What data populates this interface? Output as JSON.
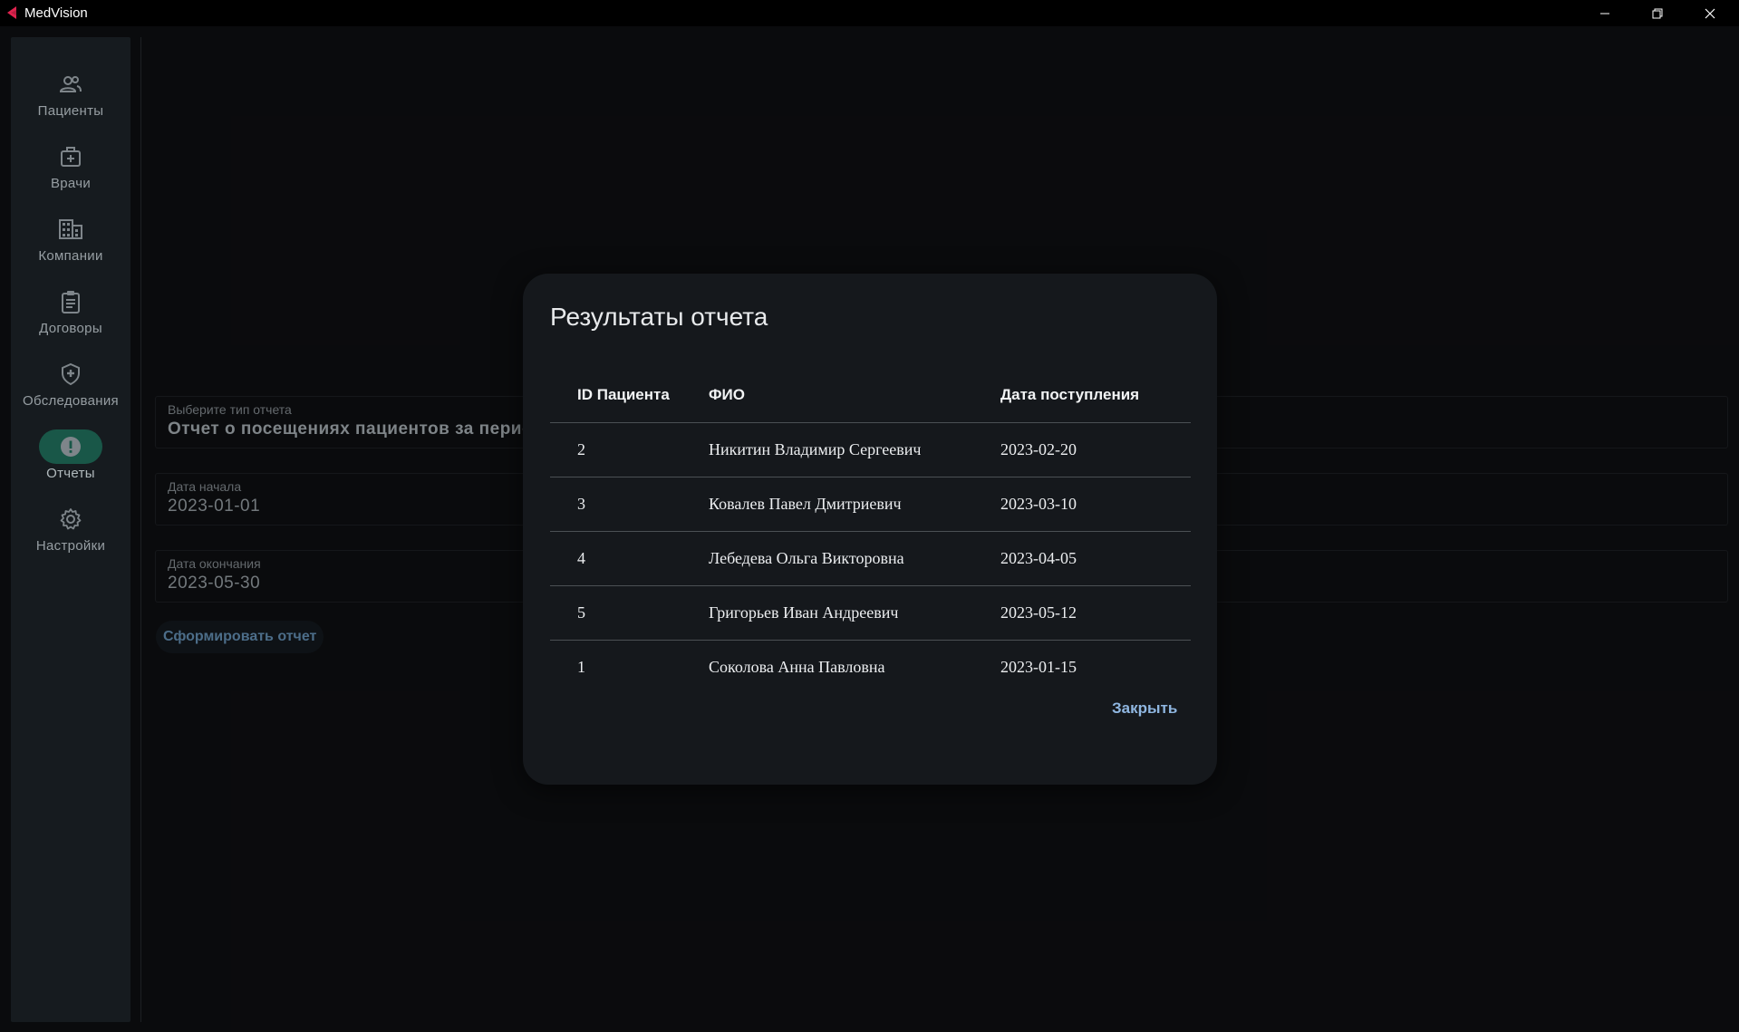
{
  "window": {
    "title": "MedVision",
    "accent_color": "#e0234e"
  },
  "sidebar": {
    "items": [
      {
        "label": "Пациенты",
        "icon": "people-icon"
      },
      {
        "label": "Врачи",
        "icon": "medical-bag-icon"
      },
      {
        "label": "Компании",
        "icon": "building-icon"
      },
      {
        "label": "Договоры",
        "icon": "clipboard-icon"
      },
      {
        "label": "Обследования",
        "icon": "shield-plus-icon"
      },
      {
        "label": "Отчеты",
        "icon": "alert-circle-icon",
        "active": true
      },
      {
        "label": "Настройки",
        "icon": "gear-icon"
      }
    ],
    "active_color": "#1f6b58"
  },
  "form": {
    "report_type_label": "Выберите тип отчета",
    "report_type_value": "Отчет о посещениях пациентов за период",
    "start_date_label": "Дата начала",
    "start_date_value": "2023-01-01",
    "end_date_label": "Дата окончания",
    "end_date_value": "2023-05-30",
    "generate_label": "Сформировать отчет"
  },
  "dialog": {
    "title": "Результаты отчета",
    "columns": [
      "ID Пациента",
      "ФИО",
      "Дата поступления"
    ],
    "rows": [
      {
        "id": "2",
        "name": "Никитин Владимир Сергеевич",
        "date": "2023-02-20"
      },
      {
        "id": "3",
        "name": "Ковалев Павел Дмитриевич",
        "date": "2023-03-10"
      },
      {
        "id": "4",
        "name": "Лебедева Ольга Викторовна",
        "date": "2023-04-05"
      },
      {
        "id": "5",
        "name": "Григорьев Иван Андреевич",
        "date": "2023-05-12"
      },
      {
        "id": "1",
        "name": "Соколова Анна Павловна",
        "date": "2023-01-15"
      }
    ],
    "close_label": "Закрыть"
  }
}
